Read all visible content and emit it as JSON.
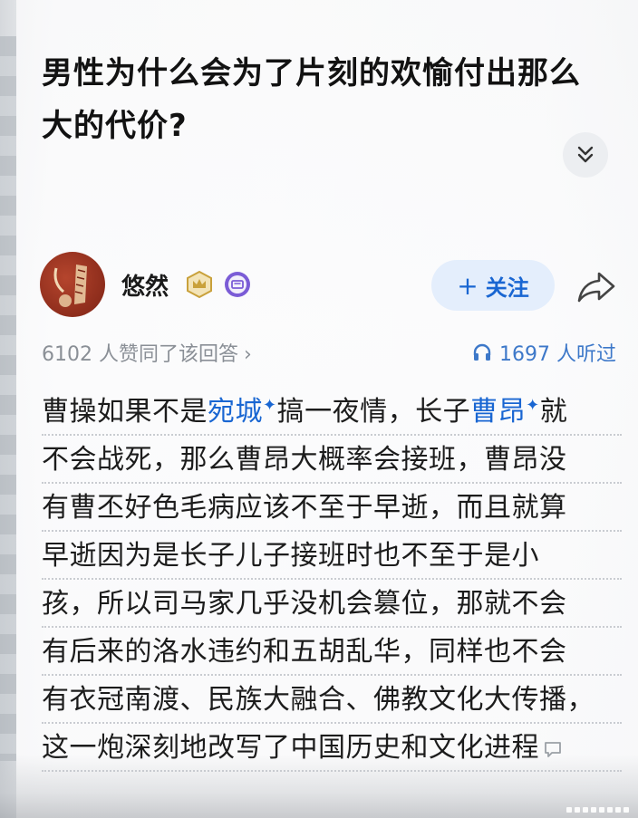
{
  "question": {
    "title_line1": "男性为什么会为了片刻的欢愉付出那么",
    "title_line2": "大的代价?"
  },
  "author": {
    "name": "悠然",
    "follow_label": "关注",
    "follow_plus": "+"
  },
  "stats": {
    "votes_text": "6102 人赞同了该回答",
    "votes_chevron": "›",
    "listen_text": "1697 人听过"
  },
  "answer": {
    "l1_a": "曹操如果不是",
    "l1_link1": "宛城",
    "l1_b": "搞一夜情，长子",
    "l1_link2": "曹昂",
    "l1_c": "就",
    "sup_mark": "✦",
    "l2": "不会战死，那么曹昂大概率会接班，曹昂没",
    "l3": "有曹丕好色毛病应该不至于早逝，而且就算",
    "l4": "早逝因为是长子儿子接班时也不至于是小",
    "l5": "孩，所以司马家几乎没机会篡位，那就不会",
    "l6": "有后来的洛水违约和五胡乱华，同样也不会",
    "l7": "有衣冠南渡、民族大融合、佛教文化大传播，",
    "l8": "这一炮深刻地改写了中国历史和文化进程"
  },
  "icons": {
    "expand": "chevron-double-down-icon",
    "share": "share-icon",
    "headphones": "headphones-icon",
    "comment": "comment-icon",
    "crown_badge": "crown-badge-icon",
    "purple_badge": "purple-badge-icon"
  },
  "colors": {
    "link": "#1966d2",
    "follow_bg": "#e4eefc",
    "muted": "#8a8f96",
    "badge_gold": "#c9a13b",
    "badge_purple": "#7b5cd6"
  }
}
